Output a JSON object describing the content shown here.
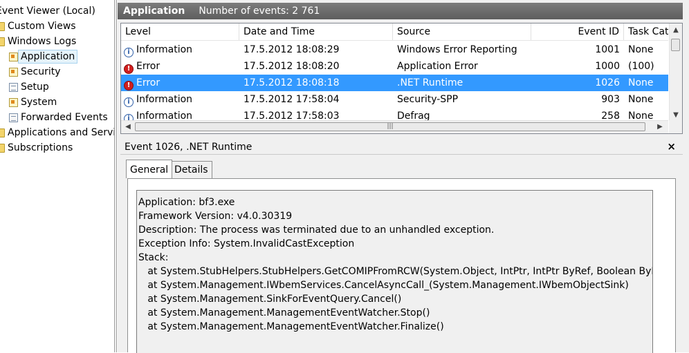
{
  "tree": {
    "root": "Event Viewer (Local)",
    "custom_views": "Custom Views",
    "windows_logs": "Windows Logs",
    "application": "Application",
    "security": "Security",
    "setup": "Setup",
    "system": "System",
    "forwarded_events": "Forwarded Events",
    "apps_services": "Applications and Services Logs",
    "subscriptions": "Subscriptions"
  },
  "header": {
    "title": "Application",
    "count_text": "Number of events: 2 761"
  },
  "grid": {
    "columns": [
      "Level",
      "Date and Time",
      "Source",
      "Event ID",
      "Task Category"
    ],
    "rows": [
      {
        "level": "Information",
        "level_icon": "info-icon",
        "datetime": "17.5.2012 18:08:29",
        "source": "Windows Error Reporting",
        "event_id": "1001",
        "task": "None"
      },
      {
        "level": "Error",
        "level_icon": "error-icon",
        "datetime": "17.5.2012 18:08:20",
        "source": "Application Error",
        "event_id": "1000",
        "task": "(100)"
      },
      {
        "level": "Error",
        "level_icon": "error-icon",
        "datetime": "17.5.2012 18:08:18",
        "source": ".NET Runtime",
        "event_id": "1026",
        "task": "None"
      },
      {
        "level": "Information",
        "level_icon": "info-icon",
        "datetime": "17.5.2012 17:58:04",
        "source": "Security-SPP",
        "event_id": "903",
        "task": "None"
      },
      {
        "level": "Information",
        "level_icon": "info-icon",
        "datetime": "17.5.2012 17:58:03",
        "source": "Defrag",
        "event_id": "258",
        "task": "None"
      }
    ],
    "selected_index": 2
  },
  "details": {
    "title": "Event 1026, .NET Runtime",
    "close": "×",
    "tabs": [
      "General",
      "Details"
    ],
    "active_tab": "General",
    "text": "Application: bf3.exe\nFramework Version: v4.0.30319\nDescription: The process was terminated due to an unhandled exception.\nException Info: System.InvalidCastException\nStack:\n   at System.StubHelpers.StubHelpers.GetCOMIPFromRCW(System.Object, IntPtr, IntPtr ByRef, Boolean ByRef)\n   at System.Management.IWbemServices.CancelAsyncCall_(System.Management.IWbemObjectSink)\n   at System.Management.SinkForEventQuery.Cancel()\n   at System.Management.ManagementEventWatcher.Stop()\n   at System.Management.ManagementEventWatcher.Finalize()"
  },
  "colors": {
    "selection": "#3399ff",
    "header_bg": "#6b6b6b",
    "error": "#d21f1f",
    "info": "#2f5fa8"
  }
}
